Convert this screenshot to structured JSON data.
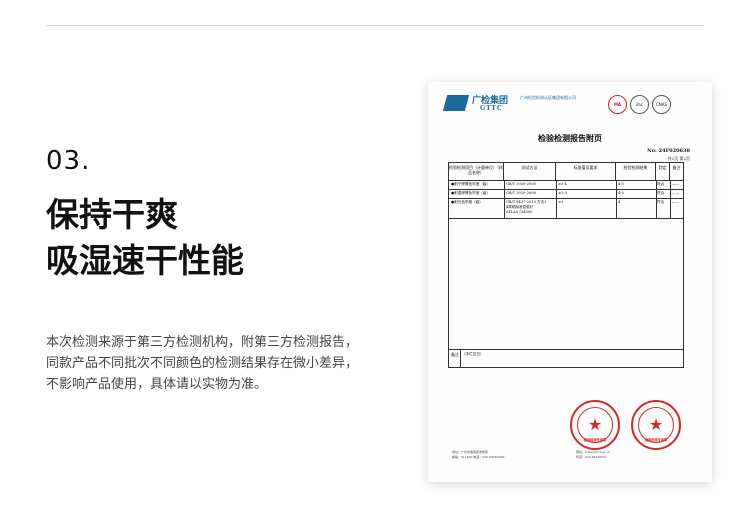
{
  "section_number": "03.",
  "title_lines": [
    "保持干爽",
    "吸湿速干性能"
  ],
  "description_lines": [
    "本次检测来源于第三方检测机构，附第三方检测报告，",
    "同款产品不同批次不同颜色的检测结果存在微小差异，",
    "不影响产品使用，具体请以实物为准。"
  ],
  "report": {
    "logo_cn": "广检集团",
    "logo_en": "GTTC",
    "org_name": "广州检验检测认证集团有限公司",
    "cert_badges": [
      "MA",
      "ilac",
      "CNAS"
    ],
    "title": "检验检测报告附页",
    "report_no": "No: 24F020638",
    "page_info": "共2页 第2页",
    "headers": [
      "检验检测项目（计量单位）（样品名称）",
      "测试方法",
      "标准值及要求",
      "检验检测结果",
      "判定",
      "备注"
    ],
    "rows": [
      {
        "item": "●耐干摩擦色牢度（级）",
        "method": "GB/T 3920-2008",
        "standard": "≥3-4",
        "result": "4-5",
        "verdict": "符合",
        "note": "——"
      },
      {
        "item": "●耐湿摩擦色牢度（级）",
        "method": "GB/T 3920-2008",
        "standard": "≥2-3",
        "result": "4-5",
        "verdict": "符合",
        "note": "——"
      },
      {
        "item": "●耐光色牢度（级）",
        "method": "GB/T 8427-2019 方法3",
        "method2": "4周晒标准氙弧灯",
        "method3": "ATLAS Ci4000",
        "standard": "≥3",
        "result": "4",
        "verdict": "符合",
        "note": "——"
      }
    ],
    "remark_label": "备注",
    "remark_text": "（本栏空白）",
    "seal_text_1": "检验检测专用章",
    "seal_text_2": "检验检测专用章",
    "footer_left": "地址：广州市番禺区市桥街",
    "footer_left2": "邮编：511400 电话：020-84560000",
    "footer_right": "网址：www.gttc.net.cn",
    "footer_right2": "传真：020-84560001"
  }
}
